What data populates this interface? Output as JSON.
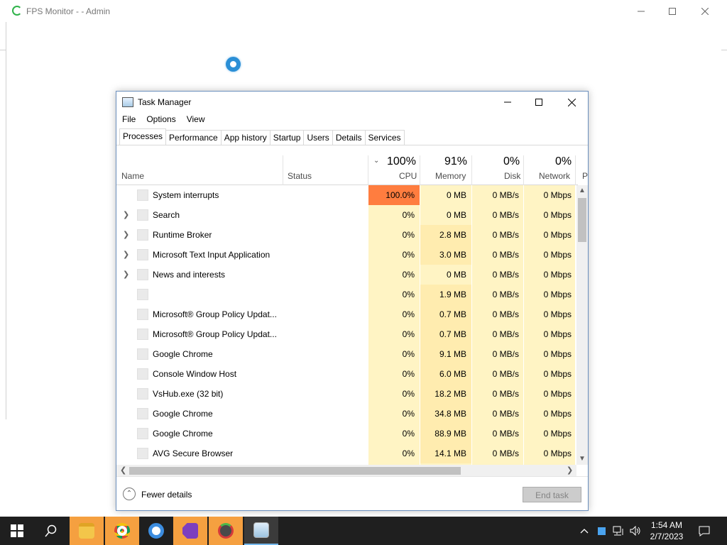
{
  "fps_monitor": {
    "title": "FPS Monitor -  - Admin"
  },
  "task_manager": {
    "title": "Task Manager",
    "menu": [
      "File",
      "Options",
      "View"
    ],
    "tabs": [
      "Processes",
      "Performance",
      "App history",
      "Startup",
      "Users",
      "Details",
      "Services"
    ],
    "active_tab": "Processes",
    "columns": {
      "name": "Name",
      "status": "Status",
      "cpu_pct": "100%",
      "cpu": "CPU",
      "memory_pct": "91%",
      "memory": "Memory",
      "disk_pct": "0%",
      "disk": "Disk",
      "network_pct": "0%",
      "network": "Network",
      "power_partial": "P"
    },
    "processes": [
      {
        "name": "System interrupts",
        "expandable": false,
        "cpu": "100.0%",
        "memory": "0 MB",
        "disk": "0 MB/s",
        "network": "0 Mbps"
      },
      {
        "name": "Search",
        "expandable": true,
        "cpu": "0%",
        "memory": "0 MB",
        "disk": "0 MB/s",
        "network": "0 Mbps"
      },
      {
        "name": "Runtime Broker",
        "expandable": true,
        "cpu": "0%",
        "memory": "2.8 MB",
        "disk": "0 MB/s",
        "network": "0 Mbps"
      },
      {
        "name": "Microsoft Text Input Application",
        "expandable": true,
        "cpu": "0%",
        "memory": "3.0 MB",
        "disk": "0 MB/s",
        "network": "0 Mbps"
      },
      {
        "name": "News and interests",
        "expandable": true,
        "cpu": "0%",
        "memory": "0 MB",
        "disk": "0 MB/s",
        "network": "0 Mbps"
      },
      {
        "name": "",
        "expandable": false,
        "cpu": "0%",
        "memory": "1.9 MB",
        "disk": "0 MB/s",
        "network": "0 Mbps"
      },
      {
        "name": "Microsoft® Group Policy Updat...",
        "expandable": false,
        "cpu": "0%",
        "memory": "0.7 MB",
        "disk": "0 MB/s",
        "network": "0 Mbps"
      },
      {
        "name": "Microsoft® Group Policy Updat...",
        "expandable": false,
        "cpu": "0%",
        "memory": "0.7 MB",
        "disk": "0 MB/s",
        "network": "0 Mbps"
      },
      {
        "name": "Google Chrome",
        "expandable": false,
        "cpu": "0%",
        "memory": "9.1 MB",
        "disk": "0 MB/s",
        "network": "0 Mbps"
      },
      {
        "name": "Console Window Host",
        "expandable": false,
        "cpu": "0%",
        "memory": "6.0 MB",
        "disk": "0 MB/s",
        "network": "0 Mbps"
      },
      {
        "name": "VsHub.exe (32 bit)",
        "expandable": false,
        "cpu": "0%",
        "memory": "18.2 MB",
        "disk": "0 MB/s",
        "network": "0 Mbps"
      },
      {
        "name": "Google Chrome",
        "expandable": false,
        "cpu": "0%",
        "memory": "34.8 MB",
        "disk": "0 MB/s",
        "network": "0 Mbps"
      },
      {
        "name": "Google Chrome",
        "expandable": false,
        "cpu": "0%",
        "memory": "88.9 MB",
        "disk": "0 MB/s",
        "network": "0 Mbps"
      },
      {
        "name": "AVG Secure Browser",
        "expandable": false,
        "cpu": "0%",
        "memory": "14.1 MB",
        "disk": "0 MB/s",
        "network": "0 Mbps"
      }
    ],
    "footer": {
      "fewer_details": "Fewer details",
      "end_task": "End task"
    }
  },
  "taskbar": {
    "apps": [
      "start-icon",
      "search-icon",
      "file-explorer-icon",
      "chrome-icon",
      "avg-browser-icon",
      "visual-studio-icon",
      "fps-monitor-icon",
      "task-manager-icon"
    ],
    "clock_time": "1:54 AM",
    "clock_date": "2/7/2023"
  },
  "colors": {
    "cpu_hot": "#ff7d3f",
    "heat_low": "#fff4c4",
    "heat_mid": "#ffecaf",
    "taskbar": "#1f1f1f",
    "taskbar_active": "#f5a040"
  }
}
